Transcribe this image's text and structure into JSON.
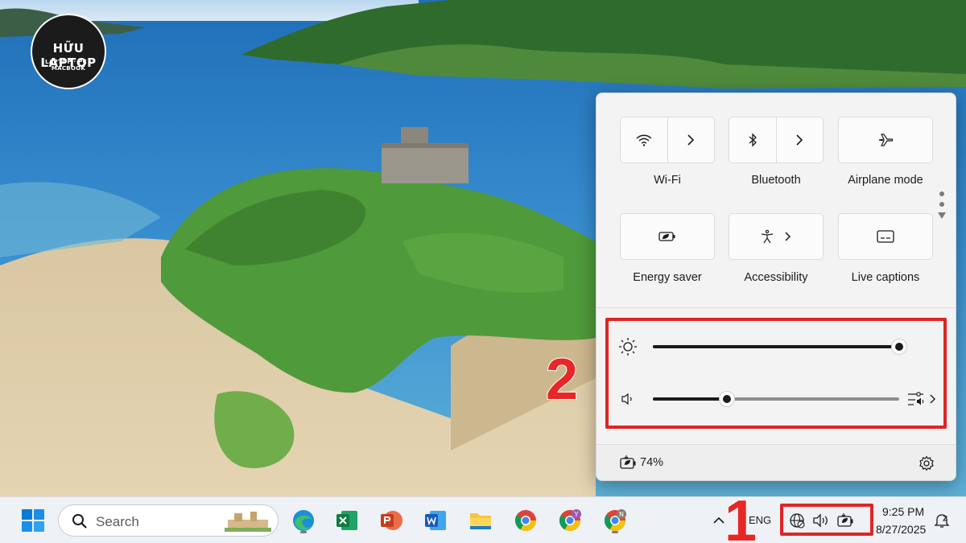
{
  "watermark": {
    "brand": "HỮU LAPTOP",
    "tagline": "LAPTOP · PC · MACBOOK"
  },
  "quick_settings": {
    "tiles": [
      {
        "label": "Wi-Fi",
        "icon": "wifi-icon",
        "has_arrow": true
      },
      {
        "label": "Bluetooth",
        "icon": "bluetooth-icon",
        "has_arrow": true
      },
      {
        "label": "Airplane mode",
        "icon": "airplane-icon",
        "has_arrow": false
      },
      {
        "label": "Energy saver",
        "icon": "energy-saver-icon",
        "has_arrow": false
      },
      {
        "label": "Accessibility",
        "icon": "accessibility-icon",
        "has_arrow": true
      },
      {
        "label": "Live captions",
        "icon": "captions-icon",
        "has_arrow": false
      }
    ],
    "brightness_level": 1.0,
    "volume_level": 0.3,
    "battery_percent": "74%"
  },
  "annotations": {
    "taskbar_marker": "1",
    "sliders_marker": "2",
    "color": "#e02424"
  },
  "taskbar": {
    "search_placeholder": "Search",
    "apps": [
      "start-icon",
      "search-icon",
      "edge-icon",
      "excel-icon",
      "powerpoint-icon",
      "word-icon",
      "file-explorer-icon",
      "chrome-icon",
      "chrome-profile-y-icon",
      "chrome-profile-n-icon"
    ],
    "language": "ENG",
    "time": "9:25 PM",
    "date": "8/27/2025"
  },
  "colors": {
    "accent": "#0067c0",
    "panel_bg": "#f3f3f3",
    "taskbar_bg": "#eef1f5"
  }
}
